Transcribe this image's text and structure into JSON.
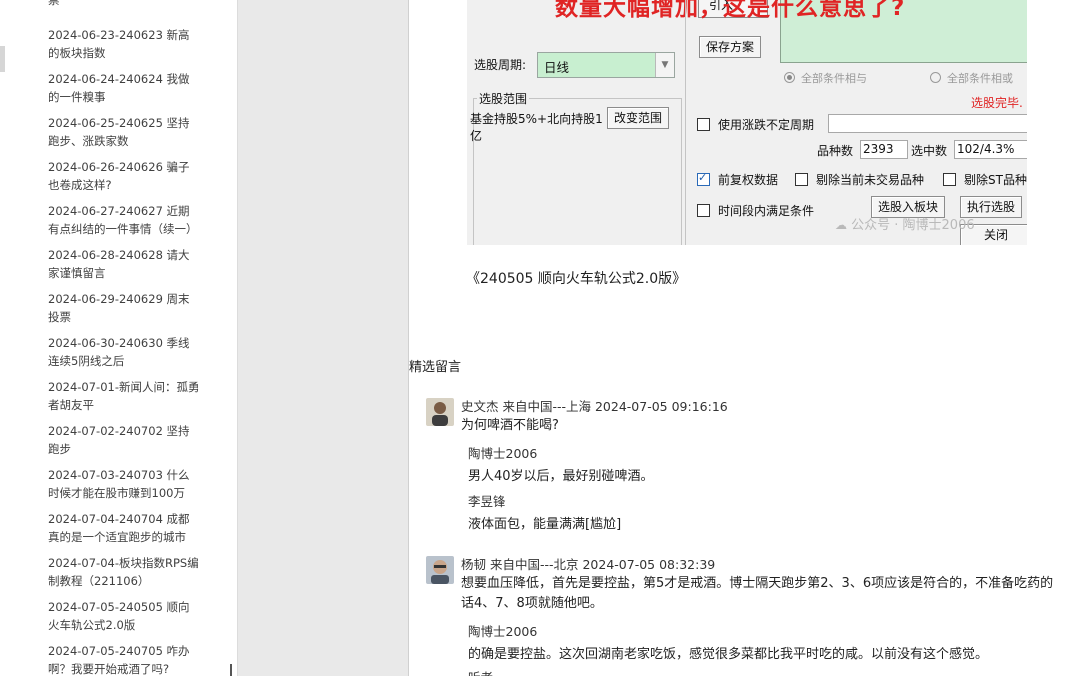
{
  "sidebar": {
    "items": [
      "票",
      "2024-06-23-240623 新高的板块指数",
      "2024-06-24-240624 我做的一件糗事",
      "2024-06-25-240625 坚持跑步、涨跌家数",
      "2024-06-26-240626 骗子也卷成这样?",
      "2024-06-27-240627 近期有点纠结的一件事情（续一）",
      "2024-06-28-240628 请大家谨慎留言",
      "2024-06-29-240629 周末投票",
      "2024-06-30-240630 季线连续5阴线之后",
      "2024-07-01-新闻人间：孤勇者胡友平",
      "2024-07-02-240702 坚持跑步",
      "2024-07-03-240703 什么时候才能在股市赚到100万",
      "2024-07-04-240704 成都真的是一个适宜跑步的城市",
      "2024-07-04-板块指数RPS编制教程（221106）",
      "2024-07-05-240505 顺向火车轨公式2.0版",
      "2024-07-05-240705 咋办啊？我要开始戒酒了吗?"
    ]
  },
  "screenshot": {
    "overlay_title": "数量大幅增加，这是什么意思了?",
    "top_button_partial": "引入",
    "save_plan": "保存方案",
    "period_label": "选股周期:",
    "period_value": "日线",
    "radio_and": "全部条件相与",
    "radio_or": "全部条件相或",
    "status": "选股完毕.",
    "range_title": "选股范围",
    "range_value": "基金持股5%+北向持股1亿",
    "change_range": "改变范围",
    "use_uncertain_period": "使用涨跌不定周期",
    "count_label": "品种数",
    "count_value": "2393",
    "selected_label": "选中数",
    "selected_value": "102/4.3%",
    "pre_adjusted": "前复权数据",
    "remove_untraded": "剔除当前未交易品种",
    "remove_st": "剔除ST品种",
    "period_satisfy": "时间段内满足条件",
    "add_to_board": "选股入板块",
    "execute": "执行选股",
    "close": "关闭",
    "watermark": "公众号 · 陶博士2006",
    "status_color": "#e02424"
  },
  "caption": "《240505 顺向火车轨公式2.0版》",
  "comments_title": "精选留言",
  "comments": [
    {
      "header": "史文杰 来自中国---上海 2024-07-05 09:16:16",
      "text": "为何啤酒不能喝?",
      "replies": [
        {
          "name": "陶博士2006",
          "text": "男人40岁以后，最好别碰啤酒。"
        },
        {
          "name": "李昱锋",
          "text": "液体面包，能量满满[尴尬]"
        }
      ]
    },
    {
      "header": "杨韧 来自中国---北京 2024-07-05 08:32:39",
      "text": "想要血压降低，首先是要控盐，第5才是戒酒。博士隔天跑步第2、3、6项应该是符合的，不准备吃药的话4、7、8项就随他吧。",
      "replies": [
        {
          "name": "陶博士2006",
          "text": "的确是要控盐。这次回湖南老家吃饭，感觉很多菜都比我平时吃的咸。以前没有这个感觉。"
        },
        {
          "name": "听者",
          "text": ""
        }
      ]
    }
  ]
}
